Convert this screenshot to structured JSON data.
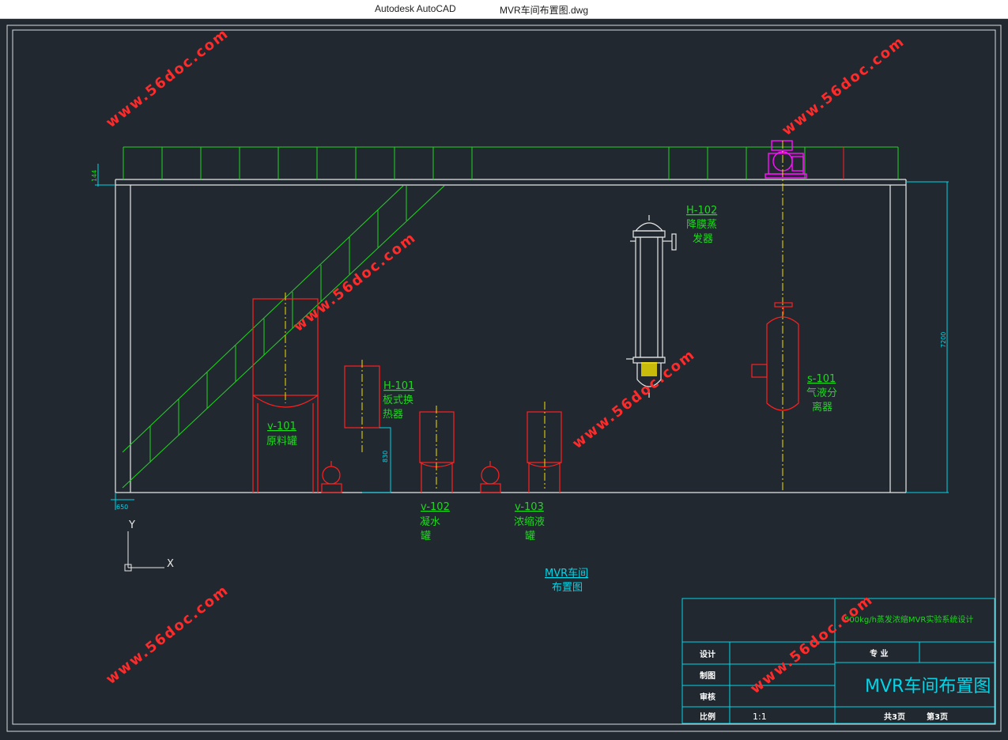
{
  "window": {
    "app_name": "Autodesk AutoCAD",
    "file_name": "MVR车间布置图.dwg"
  },
  "drawing": {
    "equipment": {
      "h102": {
        "tag": "H-102",
        "name_line1": "降膜蒸",
        "name_line2": "发器"
      },
      "h101": {
        "tag": "H-101",
        "name_line1": "板式换",
        "name_line2": "热器"
      },
      "v101": {
        "tag": "v-101",
        "name_line1": "原料罐"
      },
      "v102": {
        "tag": "v-102",
        "name_line1": "凝水",
        "name_line2": "罐"
      },
      "v103": {
        "tag": "v-103",
        "name_line1": "浓缩液",
        "name_line2": "罐"
      },
      "s101": {
        "tag": "s-101",
        "name_line1": "气液分",
        "name_line2": "离器"
      }
    },
    "dimensions": {
      "top": "144",
      "right": "7200",
      "bottom_left": "650",
      "mid": "830"
    },
    "title": {
      "line1": "MVR车间",
      "line2": "布置图"
    },
    "ucs": {
      "x_label": "X",
      "y_label": "Y"
    }
  },
  "title_block": {
    "project": "500kg/h蒸发浓缩MVR实验系统设计",
    "row_labels": [
      "设计",
      "制图",
      "审核",
      "比例"
    ],
    "scale": "1:1",
    "major_label": "专 业",
    "drawing_name": "MVR车间布置图",
    "sheets_total": "共3页",
    "sheet_no": "第3页"
  },
  "watermark": {
    "text": "www.56doc.com"
  },
  "colors": {
    "background": "#212830",
    "frame": "#00d6e8",
    "equipment": "#ff2020",
    "stairs": "#1fd81f",
    "labels": "#1fd81f",
    "centerline": "#f2e000",
    "compressor": "#ff10ff",
    "watermark": "#ff2b2b"
  }
}
